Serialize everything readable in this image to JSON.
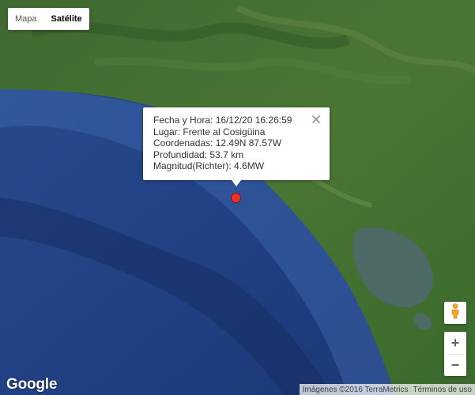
{
  "maptype": {
    "map_label": "Mapa",
    "satellite_label": "Satélite",
    "active": "satellite"
  },
  "infowindow": {
    "line1": "Fecha y Hora: 16/12/20 16:26:59",
    "line2": "Lugar: Frente al Cosigüina",
    "line3": "Coordenadas: 12.49N 87.57W",
    "line4": "Profundidad: 53.7 km",
    "line5": "Magnitud(Richter): 4.6MW"
  },
  "controls": {
    "zoom_in": "+",
    "zoom_out": "−",
    "pegman_icon": "pegman-icon"
  },
  "footer": {
    "logo": "Google",
    "imagery": "Imágenes ©2016 TerraMetrics",
    "terms": "Términos de uso"
  },
  "colors": {
    "marker": "#e8322e",
    "ocean": "#1e3a7a",
    "land": "#3d6b2f"
  }
}
